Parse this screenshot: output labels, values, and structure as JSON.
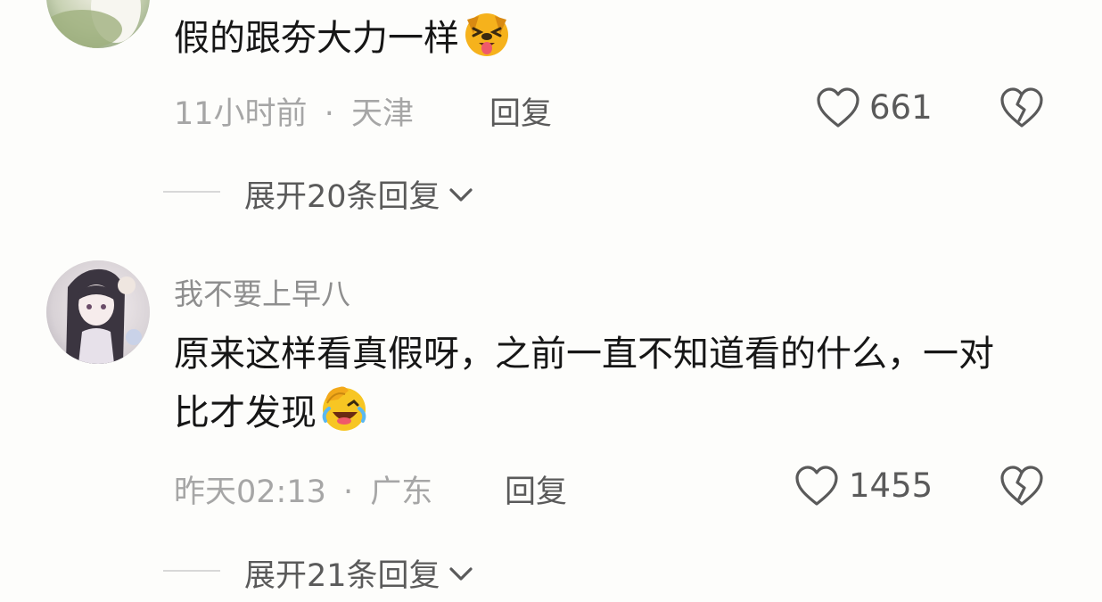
{
  "comments": [
    {
      "name": "",
      "text": "假的跟夯大力一样",
      "emoji": "dog-laughing-tongue-emoji",
      "time": "11小时前",
      "sep": "·",
      "location": "天津",
      "reply_label": "回复",
      "likes": "661",
      "expand_label": "展开20条回复"
    },
    {
      "name": "我不要上早八",
      "text": "原来这样看真假呀，之前一直不知道看的什么，一对比才发现",
      "emoji": "facepalm-laughing-emoji",
      "time": "昨天02:13",
      "sep": "·",
      "location": "广东",
      "reply_label": "回复",
      "likes": "1455",
      "expand_label": "展开21条回复"
    }
  ],
  "colors": {
    "background": "#fdfdfb",
    "text": "#161616",
    "meta": "#a6a6a6",
    "secondary": "#5a5a5a"
  }
}
